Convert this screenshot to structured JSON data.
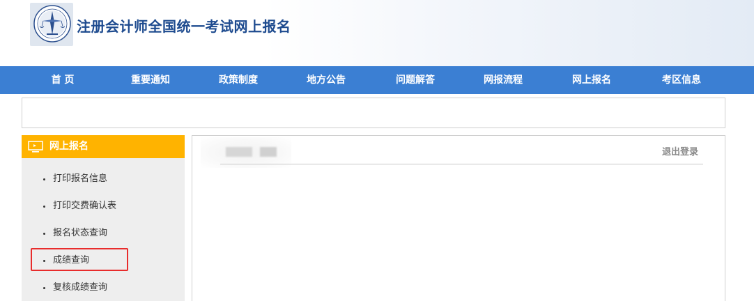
{
  "header": {
    "title": "注册会计师全国统一考试网上报名",
    "logo_icon": "cicpa-emblem-icon"
  },
  "nav": {
    "items": [
      {
        "label": "首 页"
      },
      {
        "label": "重要通知"
      },
      {
        "label": "政策制度"
      },
      {
        "label": "地方公告"
      },
      {
        "label": "问题解答"
      },
      {
        "label": "网报流程"
      },
      {
        "label": "网上报名"
      },
      {
        "label": "考区信息"
      }
    ]
  },
  "sidebar": {
    "header_label": "网上报名",
    "header_icon": "monitor-icon",
    "items": [
      {
        "label": "打印报名信息"
      },
      {
        "label": "打印交费确认表"
      },
      {
        "label": "报名状态查询"
      },
      {
        "label": "成绩查询",
        "highlighted": true
      },
      {
        "label": "复核成绩查询"
      }
    ]
  },
  "main": {
    "logout_label": "退出登录"
  },
  "colors": {
    "nav_bg": "#3b7fd3",
    "sidebar_header_bg": "#ffb300",
    "title_color": "#1e4b8f",
    "highlight_border": "#e82c2c"
  }
}
